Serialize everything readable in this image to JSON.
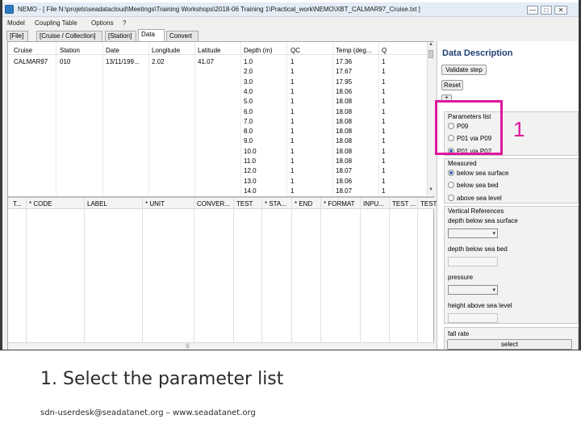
{
  "window": {
    "title": "NEMO - [ File N:\\projets\\seadatacloud\\Meetings\\Training Workshops\\2018-06 Training 1\\Practical_work\\NEMO\\XBT_CALMAR97_Cruise.txt ]",
    "min_glyph": "—",
    "max_glyph": "□",
    "close_glyph": "✕"
  },
  "menu": [
    "Model",
    "Coupling Table",
    "Options",
    "?"
  ],
  "tabs": [
    "[File]",
    "[Cruise / Collection]",
    "[Station]",
    "Data",
    "Convert"
  ],
  "data_table": {
    "columns": [
      "Cruise",
      "Station",
      "Date",
      "Longitude",
      "Latitude",
      "Depth (m)",
      "QC",
      "Temp (deg...",
      "Q"
    ],
    "first_row": {
      "cruise": "CALMAR97",
      "station": "010",
      "date": "13/11/199...",
      "longitude": "2.02",
      "latitude": "41.07"
    },
    "rows": [
      {
        "depth": "1.0",
        "qc": "1",
        "temp": "17.36",
        "q": "1"
      },
      {
        "depth": "2.0",
        "qc": "1",
        "temp": "17.67",
        "q": "1"
      },
      {
        "depth": "3.0",
        "qc": "1",
        "temp": "17.95",
        "q": "1"
      },
      {
        "depth": "4.0",
        "qc": "1",
        "temp": "18.06",
        "q": "1"
      },
      {
        "depth": "5.0",
        "qc": "1",
        "temp": "18.08",
        "q": "1"
      },
      {
        "depth": "6.0",
        "qc": "1",
        "temp": "18.08",
        "q": "1"
      },
      {
        "depth": "7.0",
        "qc": "1",
        "temp": "18.08",
        "q": "1"
      },
      {
        "depth": "8.0",
        "qc": "1",
        "temp": "18.08",
        "q": "1"
      },
      {
        "depth": "9.0",
        "qc": "1",
        "temp": "18.08",
        "q": "1"
      },
      {
        "depth": "10.0",
        "qc": "1",
        "temp": "18.08",
        "q": "1"
      },
      {
        "depth": "11.0",
        "qc": "1",
        "temp": "18.08",
        "q": "1"
      },
      {
        "depth": "12.0",
        "qc": "1",
        "temp": "18.07",
        "q": "1"
      },
      {
        "depth": "13.0",
        "qc": "1",
        "temp": "18.06",
        "q": "1"
      },
      {
        "depth": "14.0",
        "qc": "1",
        "temp": "18.07",
        "q": "1"
      }
    ]
  },
  "meta_table": {
    "columns": [
      "T...",
      "* CODE",
      "LABEL",
      "* UNIT",
      "CONVER...",
      "TEST",
      "* STA...",
      "* END",
      "* FORMAT",
      "INPU...",
      "TEST ...",
      "TEST"
    ]
  },
  "scroll": {
    "up_glyph": "▲",
    "down_glyph": "▼",
    "grip_glyph": "|||"
  },
  "panel": {
    "title": "Data Description",
    "validate_label": "Validate step",
    "reset_label": "Reset",
    "plus_label": "+",
    "parameters_list": {
      "label": "Parameters list",
      "options": [
        "P09",
        "P01 via P09",
        "P01 via P02"
      ],
      "selected": "P01 via P02"
    },
    "measured": {
      "label": "Measured",
      "options": [
        "below sea surface",
        "below sea bed",
        "above sea level"
      ],
      "selected": "below sea surface"
    },
    "vertical_refs": {
      "label": "Vertical References",
      "fields": [
        "depth below sea surface",
        "depth below sea bed",
        "pressure",
        "height above sea level"
      ]
    },
    "select_arrow": "▾",
    "fall_rate_label": "fall rate",
    "select_label": "select"
  },
  "annotation": {
    "number": "1",
    "color": "#e0169c"
  },
  "slide": {
    "caption": "1. Select the parameter list",
    "footer": "sdn-userdesk@seadatanet.org – www.seadatanet.org"
  }
}
